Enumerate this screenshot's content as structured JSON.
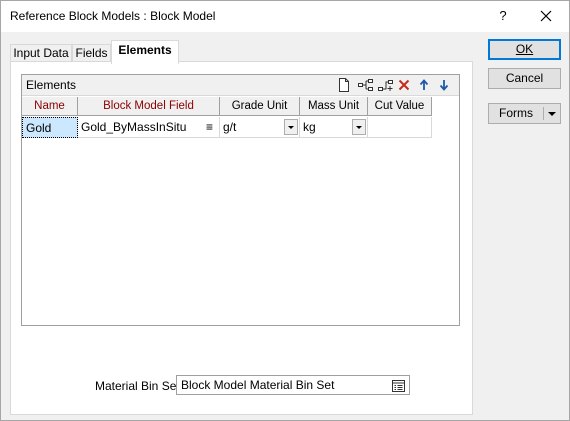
{
  "window": {
    "title": "Reference Block Models : Block Model",
    "help": "?"
  },
  "tabs": [
    {
      "label": "Input Data",
      "active": false
    },
    {
      "label": "Fields",
      "active": false
    },
    {
      "label": "Elements",
      "active": true
    }
  ],
  "elements_group": {
    "title": "Elements",
    "toolbar_icons": [
      "new-row-icon",
      "insert-row-icon",
      "append-row-icon",
      "delete-row-icon",
      "move-up-icon",
      "move-down-icon"
    ],
    "columns": [
      "Name",
      "Block Model Field",
      "Grade Unit",
      "Mass Unit",
      "Cut Value"
    ],
    "rows": [
      {
        "name": "Gold",
        "block_model_field": "Gold_ByMassInSitu",
        "grade_unit": "g/t",
        "mass_unit": "kg",
        "cut_value": ""
      }
    ]
  },
  "material_bin_set": {
    "label": "Material Bin Set",
    "value": "Block Model Material Bin Set"
  },
  "buttons": {
    "ok": "OK",
    "cancel": "Cancel",
    "forms": "Forms"
  },
  "colors": {
    "default_button_border": "#0078d7",
    "required_header_text": "#8b0000",
    "delete_icon": "#c42b1c",
    "arrow_icon": "#1e5aa8",
    "selection": "#cce8ff"
  }
}
